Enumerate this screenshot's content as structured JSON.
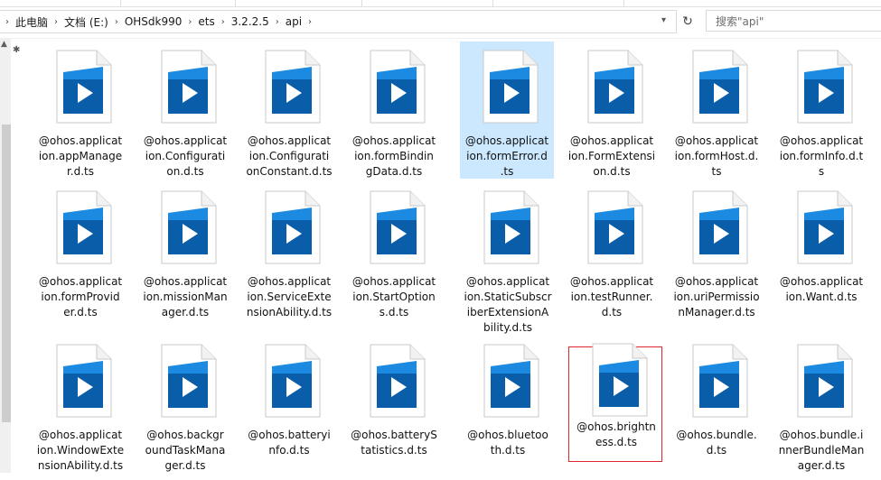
{
  "breadcrumb": {
    "items": [
      "此电脑",
      "文档 (E:)",
      "OHSdk990",
      "ets",
      "3.2.2.5",
      "api"
    ]
  },
  "search": {
    "placeholder": "搜索\"api\""
  },
  "files": [
    {
      "name": "@ohos.applicat ion.appManage r.d.ts",
      "lines": [
        "@ohos.applicat",
        "ion.appManage",
        "r.d.ts"
      ]
    },
    {
      "name": "@ohos.applicat ion.Configurati on.d.ts",
      "lines": [
        "@ohos.applicat",
        "ion.Configurati",
        "on.d.ts"
      ]
    },
    {
      "name": "@ohos.applicat ion.Configurati onConstant.d.ts",
      "lines": [
        "@ohos.applicat",
        "ion.Configurati",
        "onConstant.d.ts"
      ]
    },
    {
      "name": "@ohos.applicat ion.formBindin gData.d.ts",
      "lines": [
        "@ohos.applicat",
        "ion.formBindin",
        "gData.d.ts"
      ]
    },
    {
      "name": "@ohos.applicat ion.formError.d .ts",
      "lines": [
        "@ohos.applicat",
        "ion.formError.d",
        ".ts"
      ]
    },
    {
      "name": "@ohos.applicat ion.FormExtensi on.d.ts",
      "lines": [
        "@ohos.applicat",
        "ion.FormExtensi",
        "on.d.ts"
      ]
    },
    {
      "name": "@ohos.applicat ion.formHost.d. ts",
      "lines": [
        "@ohos.applicat",
        "ion.formHost.d.",
        "ts"
      ]
    },
    {
      "name": "@ohos.applicat ion.formInfo.d.t s",
      "lines": [
        "@ohos.applicat",
        "ion.formInfo.d.t",
        "s"
      ]
    },
    {
      "name": "@ohos.applicat ion.formProvid er.d.ts",
      "lines": [
        "@ohos.applicat",
        "ion.formProvid",
        "er.d.ts"
      ]
    },
    {
      "name": "@ohos.applicat ion.missionMan ager.d.ts",
      "lines": [
        "@ohos.applicat",
        "ion.missionMan",
        "ager.d.ts"
      ]
    },
    {
      "name": "@ohos.applicat ion.ServiceExte nsionAbility.d.ts",
      "lines": [
        "@ohos.applicat",
        "ion.ServiceExte",
        "nsionAbility.d.ts"
      ]
    },
    {
      "name": "@ohos.applicat ion.StartOption s.d.ts",
      "lines": [
        "@ohos.applicat",
        "ion.StartOption",
        "s.d.ts"
      ]
    },
    {
      "name": "@ohos.applicat ion.StaticSubscr iberExtensionA bility.d.ts",
      "lines": [
        "@ohos.applicat",
        "ion.StaticSubscr",
        "iberExtensionA",
        "bility.d.ts"
      ]
    },
    {
      "name": "@ohos.applicat ion.testRunner. d.ts",
      "lines": [
        "@ohos.applicat",
        "ion.testRunner.",
        "d.ts"
      ]
    },
    {
      "name": "@ohos.applicat ion.uriPermissio nManager.d.ts",
      "lines": [
        "@ohos.applicat",
        "ion.uriPermissio",
        "nManager.d.ts"
      ]
    },
    {
      "name": "@ohos.applicat ion.Want.d.ts",
      "lines": [
        "@ohos.applicat",
        "ion.Want.d.ts"
      ]
    },
    {
      "name": "@ohos.applicat ion.WindowExte nsionAbility.d.ts",
      "lines": [
        "@ohos.applicat",
        "ion.WindowExte",
        "nsionAbility.d.ts"
      ]
    },
    {
      "name": "@ohos.backgr oundTaskMana ger.d.ts",
      "lines": [
        "@ohos.backgr",
        "oundTaskMana",
        "ger.d.ts"
      ]
    },
    {
      "name": "@ohos.batteryi nfo.d.ts",
      "lines": [
        "@ohos.batteryi",
        "nfo.d.ts"
      ]
    },
    {
      "name": "@ohos.batteryS tatistics.d.ts",
      "lines": [
        "@ohos.batteryS",
        "tatistics.d.ts"
      ]
    },
    {
      "name": "@ohos.bluetoo th.d.ts",
      "lines": [
        "@ohos.bluetoo",
        "th.d.ts"
      ]
    },
    {
      "name": "@ohos.brightn ess.d.ts",
      "lines": [
        "@ohos.brightn",
        "ess.d.ts"
      ]
    },
    {
      "name": "@ohos.bundle. d.ts",
      "lines": [
        "@ohos.bundle.",
        "d.ts"
      ]
    },
    {
      "name": "@ohos.bundle.i nnerBundleMan ager.d.ts",
      "lines": [
        "@ohos.bundle.i",
        "nnerBundleMan",
        "ager.d.ts"
      ]
    }
  ],
  "selected_file": "@ohos.applicat ion.formError.d .ts",
  "highlighted_file": "@ohos.brightn ess.d.ts",
  "icon": "ts-file-play-icon",
  "colors": {
    "selection": "#cce8ff",
    "highlight_border": "#e1252c",
    "icon_blue_dark": "#0a5da8",
    "icon_blue_light": "#1b8ae0"
  }
}
